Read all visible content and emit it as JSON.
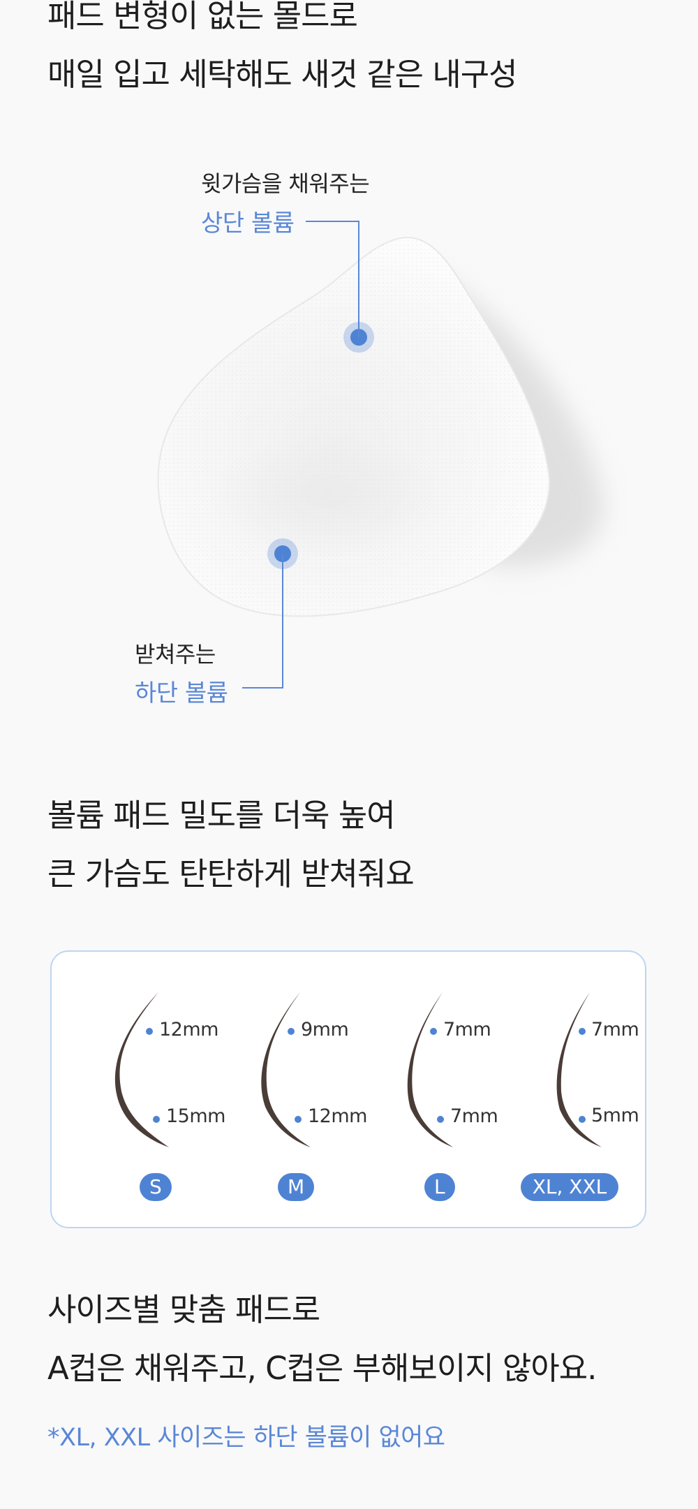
{
  "section1": {
    "line1": "패드 변형이 없는  몰드로",
    "line2": "매일 입고 세탁해도 새것 같은 내구성"
  },
  "callouts": {
    "upper": {
      "sub": "윗가슴을 채워주는",
      "main": "상단 볼륨"
    },
    "lower": {
      "sub": "받쳐주는",
      "main": "하단 볼륨"
    }
  },
  "section2": {
    "line1": "볼륨 패드 밀도를 더욱 높여",
    "line2": "큰 가슴도 탄탄하게 받쳐줘요"
  },
  "sizes": [
    {
      "label": "S",
      "top": "12mm",
      "bottom": "15mm"
    },
    {
      "label": "M",
      "top": "9mm",
      "bottom": "12mm"
    },
    {
      "label": "L",
      "top": "7mm",
      "bottom": "7mm"
    },
    {
      "label": "XL, XXL",
      "top": "7mm",
      "bottom": "5mm"
    }
  ],
  "section3": {
    "line1": "사이즈별 맞춤 패드로",
    "line2": "A컵은 채워주고, C컵은 부해보이지 않아요."
  },
  "note": "*XL, XXL 사이즈는 하단 볼륨이 없어요",
  "colors": {
    "accent": "#5a87d6",
    "pad_profile": "#4a3c37",
    "panel_border": "#bcd6ef"
  }
}
